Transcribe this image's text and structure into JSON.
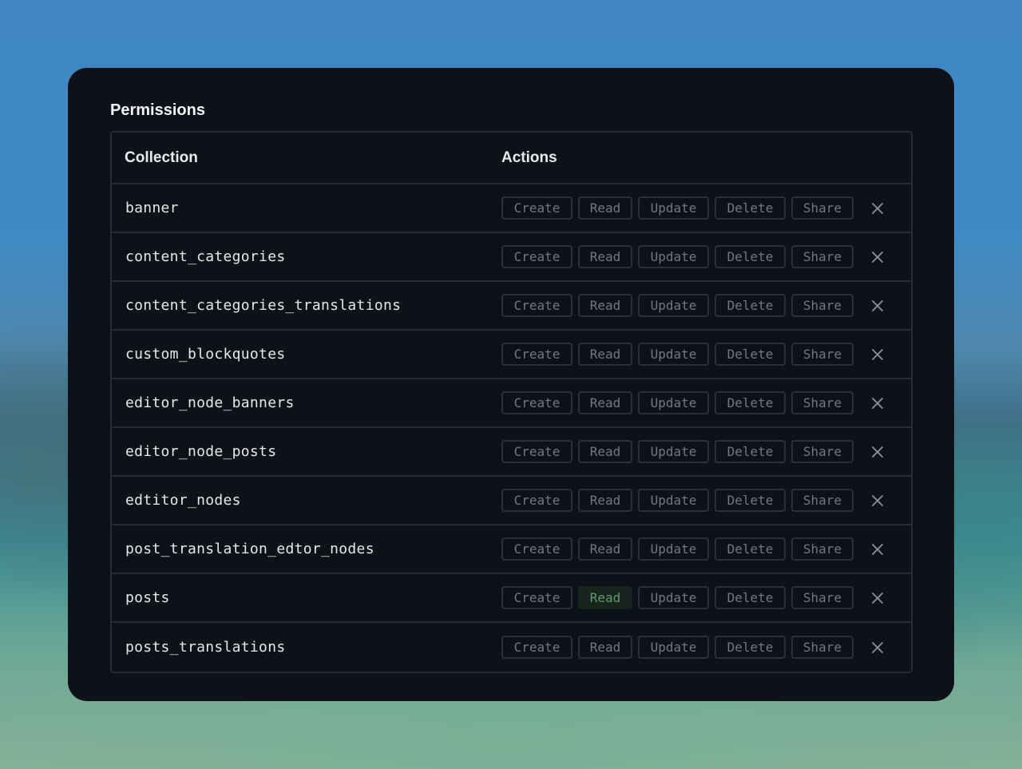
{
  "title": "Permissions",
  "columns": {
    "collection": "Collection",
    "actions": "Actions"
  },
  "action_labels": [
    "Create",
    "Read",
    "Update",
    "Delete",
    "Share"
  ],
  "colors": {
    "card_background": "#0d1219",
    "active_chip_text": "#5f9a6e",
    "inactive_chip_text": "#707884"
  },
  "rows": [
    {
      "name": "banner",
      "active": []
    },
    {
      "name": "content_categories",
      "active": []
    },
    {
      "name": "content_categories_translations",
      "active": []
    },
    {
      "name": "custom_blockquotes",
      "active": []
    },
    {
      "name": "editor_node_banners",
      "active": []
    },
    {
      "name": "editor_node_posts",
      "active": []
    },
    {
      "name": "edtitor_nodes",
      "active": []
    },
    {
      "name": "post_translation_edtor_nodes",
      "active": []
    },
    {
      "name": "posts",
      "active": [
        "Read"
      ]
    },
    {
      "name": "posts_translations",
      "active": []
    }
  ],
  "remove_icon": "close-icon"
}
